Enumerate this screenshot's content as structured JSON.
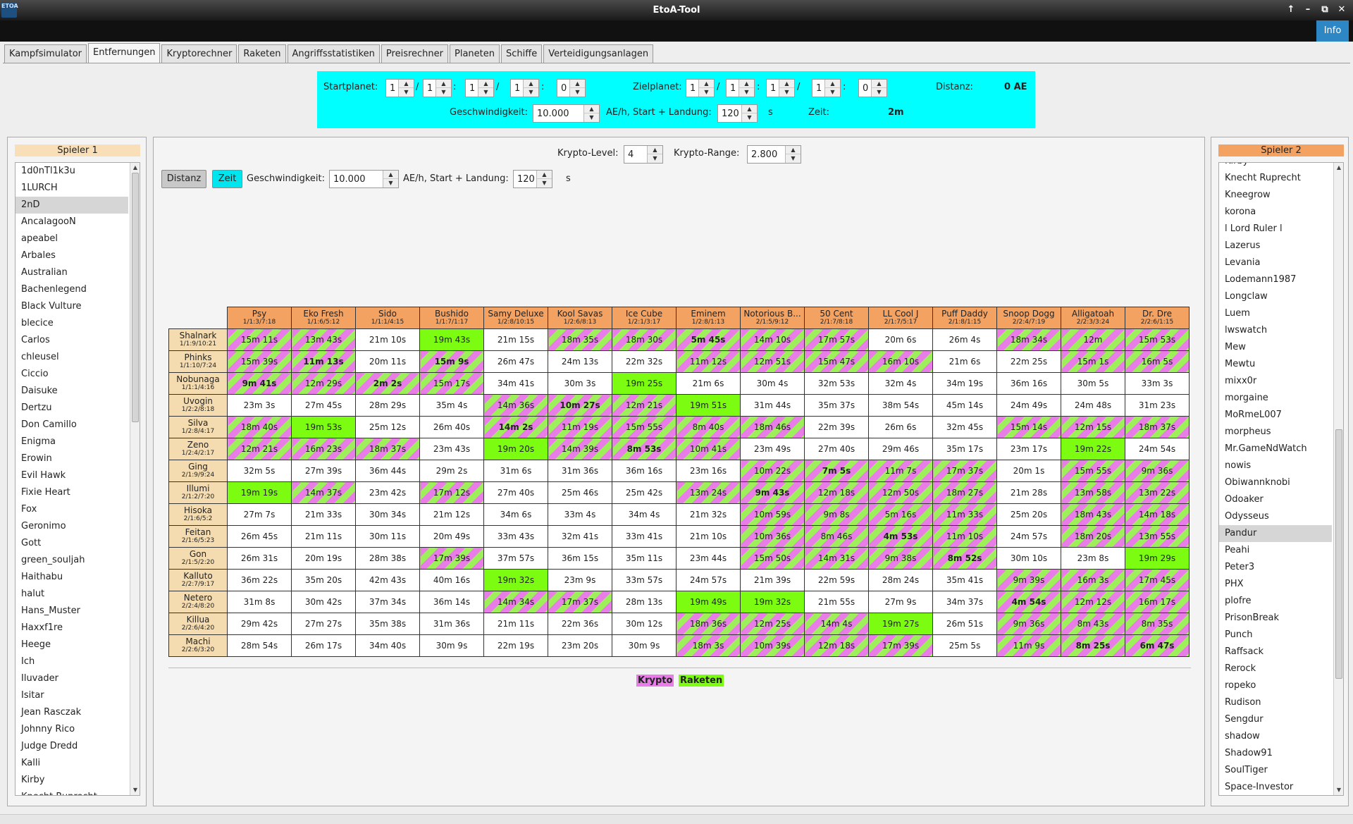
{
  "window": {
    "title": "EtoA-Tool",
    "icon_text": "ETOA",
    "buttons": [
      "↑",
      "–",
      "⧉",
      "✕"
    ]
  },
  "menubar": {
    "info": "Info"
  },
  "tabs": [
    "Kampfsimulator",
    "Entfernungen",
    "Kryptorechner",
    "Raketen",
    "Angriffsstatistiken",
    "Preisrechner",
    "Planeten",
    "Schiffe",
    "Verteidigungsanlagen"
  ],
  "active_tab": 1,
  "distance": {
    "start_label": "Startplanet:",
    "start": [
      "1",
      "1",
      "1",
      "1",
      "0"
    ],
    "target_label": "Zielplanet:",
    "target": [
      "1",
      "1",
      "1",
      "1",
      "0"
    ],
    "dist_label": "Distanz:",
    "dist_value": "0 AE",
    "speed_label": "Geschwindigkeit:",
    "speed": "10.000",
    "unit_label": "AE/h, Start + Landung:",
    "startland": "120",
    "s": "s",
    "time_label": "Zeit:",
    "time_value": "2m",
    "sep_slash": "/",
    "sep_colon": ":"
  },
  "players1": {
    "header": "Spieler 1",
    "items": [
      "1d0nTl1k3u",
      "1LURCH",
      "2nD",
      "AncalagooN",
      "apeabel",
      "Arbales",
      "Australian",
      "Bachenlegend",
      "Black Vulture",
      "blecice",
      "Carlos",
      "chleusel",
      "Ciccio",
      "Daisuke",
      "Dertzu",
      "Don Camillo",
      "Enigma",
      "Erowin",
      "Evil Hawk",
      "Fixie Heart",
      "Fox",
      "Geronimo",
      "Gott",
      "green_souljah",
      "Haithabu",
      "halut",
      "Hans_Muster",
      "Haxxf1re",
      "Heege",
      "Ich",
      "Iluvader",
      "Isitar",
      "Jean Rasczak",
      "Johnny Rico",
      "Judge Dredd",
      "Kalli",
      "Kirby",
      "Knecht Ruprecht"
    ],
    "selected": 2
  },
  "players2": {
    "header": "Spieler 2",
    "items": [
      "Kirby",
      "Knecht Ruprecht",
      "Kneegrow",
      "korona",
      "l Lord Ruler l",
      "Lazerus",
      "Levania",
      "Lodemann1987",
      "Longclaw",
      "Luem",
      "lwswatch",
      "Mew",
      "Mewtu",
      "mixx0r",
      "morgaine",
      "MoRmeL007",
      "morpheus",
      "Mr.GameNdWatch",
      "nowis",
      "Obiwannknobi",
      "Odoaker",
      "Odysseus",
      "Pandur",
      "Peahi",
      "Peter3",
      "PHX",
      "plofre",
      "PrisonBreak",
      "Punch",
      "Raffsack",
      "Rerock",
      "ropeko",
      "Rudison",
      "Sengdur",
      "shadow",
      "Shadow91",
      "SoulTiger",
      "Space-Investor"
    ],
    "selected": 22
  },
  "controls": {
    "krypto_level_label": "Krypto-Level:",
    "krypto_level": "4",
    "krypto_range_label": "Krypto-Range:",
    "krypto_range": "2.800",
    "btn_distanz": "Distanz",
    "btn_zeit": "Zeit",
    "speed_label": "Geschwindigkeit:",
    "speed": "10.000",
    "unit_label": "AE/h, Start + Landung:",
    "startland": "120",
    "s": "s"
  },
  "colors": {
    "krypto": "#e87de8",
    "raketen": "#7cfc10",
    "column_header": "#f4a261",
    "row_header": "#f4dcb0",
    "highlight": "#00ffff"
  },
  "matrix": {
    "columns": [
      {
        "name": "Psy",
        "coords": "1/1:3/7:18"
      },
      {
        "name": "Eko Fresh",
        "coords": "1/1:6/5:12"
      },
      {
        "name": "Sido",
        "coords": "1/1:1/4:15"
      },
      {
        "name": "Bushido",
        "coords": "1/1:7/1:17"
      },
      {
        "name": "Samy Deluxe",
        "coords": "1/2:8/10:15"
      },
      {
        "name": "Kool Savas",
        "coords": "1/2:6/8:13"
      },
      {
        "name": "Ice Cube",
        "coords": "1/2:1/3:17"
      },
      {
        "name": "Eminem",
        "coords": "1/2:8/1:13"
      },
      {
        "name": "Notorious B...",
        "coords": "2/1:5/9:12"
      },
      {
        "name": "50 Cent",
        "coords": "2/1:7/8:18"
      },
      {
        "name": "LL Cool J",
        "coords": "2/1:7/5:17"
      },
      {
        "name": "Puff Daddy",
        "coords": "2/1:8/1:15"
      },
      {
        "name": "Snoop Dogg",
        "coords": "2/2:4/7:19"
      },
      {
        "name": "Alligatoah",
        "coords": "2/2:3/3:24"
      },
      {
        "name": "Dr. Dre",
        "coords": "2/2:6/1:15"
      }
    ],
    "rows": [
      {
        "name": "Shalnark",
        "coords": "1/1:9/10:21",
        "cells": [
          "15m 11s",
          "13m 43s",
          "21m 10s",
          "19m 43s",
          "21m 15s",
          "18m 35s",
          "18m 30s",
          "5m 45s",
          "14m 10s",
          "17m 57s",
          "20m 6s",
          "26m 4s",
          "18m 34s",
          "12m",
          "15m 53s"
        ],
        "types": [
          1,
          1,
          0,
          2,
          0,
          1,
          1,
          1,
          1,
          1,
          0,
          0,
          1,
          1,
          1
        ],
        "bold": [
          7
        ]
      },
      {
        "name": "Phinks",
        "coords": "1/1:10/7:24",
        "cells": [
          "15m 39s",
          "11m 13s",
          "20m 11s",
          "15m 9s",
          "26m 47s",
          "24m 13s",
          "22m 32s",
          "11m 12s",
          "12m 51s",
          "15m 47s",
          "16m 10s",
          "21m 6s",
          "22m 25s",
          "15m 1s",
          "16m 5s"
        ],
        "types": [
          1,
          1,
          0,
          1,
          0,
          0,
          0,
          1,
          1,
          1,
          1,
          0,
          0,
          1,
          1
        ],
        "bold": [
          1,
          3
        ]
      },
      {
        "name": "Nobunaga",
        "coords": "1/1:1/4:16",
        "cells": [
          "9m 41s",
          "12m 29s",
          "2m 2s",
          "15m 17s",
          "34m 41s",
          "30m 3s",
          "19m 25s",
          "21m 6s",
          "30m 4s",
          "32m 53s",
          "32m 4s",
          "34m 19s",
          "36m 16s",
          "30m 5s",
          "33m 3s"
        ],
        "types": [
          1,
          1,
          1,
          1,
          0,
          0,
          2,
          0,
          0,
          0,
          0,
          0,
          0,
          0,
          0
        ],
        "bold": [
          0,
          2
        ]
      },
      {
        "name": "Uvogin",
        "coords": "1/2:2/8:18",
        "cells": [
          "23m 3s",
          "27m 45s",
          "28m 29s",
          "35m 4s",
          "14m 36s",
          "10m 27s",
          "12m 21s",
          "19m 51s",
          "31m 44s",
          "35m 37s",
          "38m 54s",
          "45m 14s",
          "24m 49s",
          "24m 48s",
          "31m 23s"
        ],
        "types": [
          0,
          0,
          0,
          0,
          1,
          1,
          1,
          2,
          0,
          0,
          0,
          0,
          0,
          0,
          0
        ],
        "bold": [
          5
        ]
      },
      {
        "name": "Silva",
        "coords": "1/2:8/4:17",
        "cells": [
          "18m 40s",
          "19m 53s",
          "25m 12s",
          "26m 40s",
          "14m 2s",
          "11m 19s",
          "15m 55s",
          "8m 40s",
          "18m 46s",
          "22m 39s",
          "26m 6s",
          "32m 45s",
          "15m 14s",
          "12m 15s",
          "18m 37s"
        ],
        "types": [
          1,
          2,
          0,
          0,
          1,
          1,
          1,
          1,
          1,
          0,
          0,
          0,
          1,
          1,
          1
        ],
        "bold": [
          4
        ]
      },
      {
        "name": "Zeno",
        "coords": "1/2:4/2:17",
        "cells": [
          "12m 21s",
          "16m 23s",
          "18m 37s",
          "23m 43s",
          "19m 20s",
          "14m 39s",
          "8m 53s",
          "10m 41s",
          "23m 49s",
          "27m 40s",
          "29m 46s",
          "35m 17s",
          "23m 17s",
          "19m 22s",
          "24m 54s"
        ],
        "types": [
          1,
          1,
          1,
          0,
          2,
          1,
          1,
          1,
          0,
          0,
          0,
          0,
          0,
          2,
          0
        ],
        "bold": [
          6
        ]
      },
      {
        "name": "Ging",
        "coords": "2/1:9/9:24",
        "cells": [
          "32m 5s",
          "27m 39s",
          "36m 44s",
          "29m 2s",
          "31m 6s",
          "31m 36s",
          "36m 16s",
          "23m 16s",
          "10m 22s",
          "7m 5s",
          "11m 7s",
          "17m 37s",
          "20m 1s",
          "15m 55s",
          "9m 36s"
        ],
        "types": [
          0,
          0,
          0,
          0,
          0,
          0,
          0,
          0,
          1,
          1,
          1,
          1,
          0,
          1,
          1
        ],
        "bold": [
          9
        ]
      },
      {
        "name": "Illumi",
        "coords": "2/1:2/7:20",
        "cells": [
          "19m 19s",
          "14m 37s",
          "23m 42s",
          "17m 12s",
          "27m 40s",
          "25m 46s",
          "25m 42s",
          "13m 24s",
          "9m 43s",
          "12m 18s",
          "12m 50s",
          "18m 27s",
          "21m 28s",
          "13m 58s",
          "13m 22s"
        ],
        "types": [
          2,
          1,
          0,
          1,
          0,
          0,
          0,
          1,
          1,
          1,
          1,
          1,
          0,
          1,
          1
        ],
        "bold": [
          8
        ]
      },
      {
        "name": "Hisoka",
        "coords": "2/1:6/5:2",
        "cells": [
          "27m 7s",
          "21m 33s",
          "30m 34s",
          "21m 12s",
          "34m 6s",
          "33m 4s",
          "34m 4s",
          "21m 32s",
          "10m 59s",
          "9m 8s",
          "5m 16s",
          "11m 33s",
          "25m 20s",
          "18m 43s",
          "14m 18s"
        ],
        "types": [
          0,
          0,
          0,
          0,
          0,
          0,
          0,
          0,
          1,
          1,
          1,
          1,
          0,
          1,
          1
        ],
        "bold": []
      },
      {
        "name": "Feitan",
        "coords": "2/1:6/5:23",
        "cells": [
          "26m 45s",
          "21m 11s",
          "30m 11s",
          "20m 49s",
          "33m 43s",
          "32m 41s",
          "33m 41s",
          "21m 10s",
          "10m 36s",
          "8m 46s",
          "4m 53s",
          "11m 10s",
          "24m 57s",
          "18m 20s",
          "13m 55s"
        ],
        "types": [
          0,
          0,
          0,
          0,
          0,
          0,
          0,
          0,
          1,
          1,
          1,
          1,
          0,
          1,
          1
        ],
        "bold": [
          10
        ]
      },
      {
        "name": "Gon",
        "coords": "2/1:5/2:20",
        "cells": [
          "26m 31s",
          "20m 19s",
          "28m 38s",
          "17m 39s",
          "37m 57s",
          "36m 15s",
          "35m 11s",
          "23m 44s",
          "15m 50s",
          "14m 31s",
          "9m 38s",
          "8m 52s",
          "30m 10s",
          "23m 8s",
          "19m 29s"
        ],
        "types": [
          0,
          0,
          0,
          1,
          0,
          0,
          0,
          0,
          1,
          1,
          1,
          1,
          0,
          0,
          2
        ],
        "bold": [
          11
        ]
      },
      {
        "name": "Kalluto",
        "coords": "2/2:7/9:17",
        "cells": [
          "36m 22s",
          "35m 20s",
          "42m 43s",
          "40m 16s",
          "19m 32s",
          "23m 9s",
          "33m 57s",
          "24m 57s",
          "21m 39s",
          "22m 59s",
          "28m 24s",
          "35m 41s",
          "9m 39s",
          "16m 3s",
          "17m 45s"
        ],
        "types": [
          0,
          0,
          0,
          0,
          2,
          0,
          0,
          0,
          0,
          0,
          0,
          0,
          1,
          1,
          1
        ],
        "bold": []
      },
      {
        "name": "Netero",
        "coords": "2/2:4/8:20",
        "cells": [
          "31m 8s",
          "30m 42s",
          "37m 34s",
          "36m 14s",
          "14m 34s",
          "17m 37s",
          "28m 13s",
          "19m 49s",
          "19m 32s",
          "21m 55s",
          "27m 9s",
          "34m 37s",
          "4m 54s",
          "12m 12s",
          "16m 17s"
        ],
        "types": [
          0,
          0,
          0,
          0,
          1,
          1,
          0,
          2,
          2,
          0,
          0,
          0,
          1,
          1,
          1
        ],
        "bold": [
          12
        ]
      },
      {
        "name": "Killua",
        "coords": "2/2:6/4:20",
        "cells": [
          "29m 42s",
          "27m 27s",
          "35m 38s",
          "31m 36s",
          "21m 11s",
          "22m 36s",
          "30m 12s",
          "18m 36s",
          "12m 25s",
          "14m 4s",
          "19m 27s",
          "26m 51s",
          "9m 36s",
          "8m 43s",
          "8m 35s"
        ],
        "types": [
          0,
          0,
          0,
          0,
          0,
          0,
          0,
          1,
          1,
          1,
          2,
          0,
          1,
          1,
          1
        ],
        "bold": []
      },
      {
        "name": "Machi",
        "coords": "2/2:6/3:20",
        "cells": [
          "28m 54s",
          "26m 17s",
          "34m 40s",
          "30m 9s",
          "22m 19s",
          "23m 20s",
          "30m 9s",
          "18m 3s",
          "10m 39s",
          "12m 18s",
          "17m 39s",
          "25m 5s",
          "11m 9s",
          "8m 25s",
          "6m 47s"
        ],
        "types": [
          0,
          0,
          0,
          0,
          0,
          0,
          0,
          1,
          1,
          1,
          1,
          0,
          1,
          1,
          1
        ],
        "bold": [
          13,
          14
        ]
      }
    ]
  },
  "legend": {
    "krypto": "Krypto",
    "raketen": "Raketen"
  }
}
